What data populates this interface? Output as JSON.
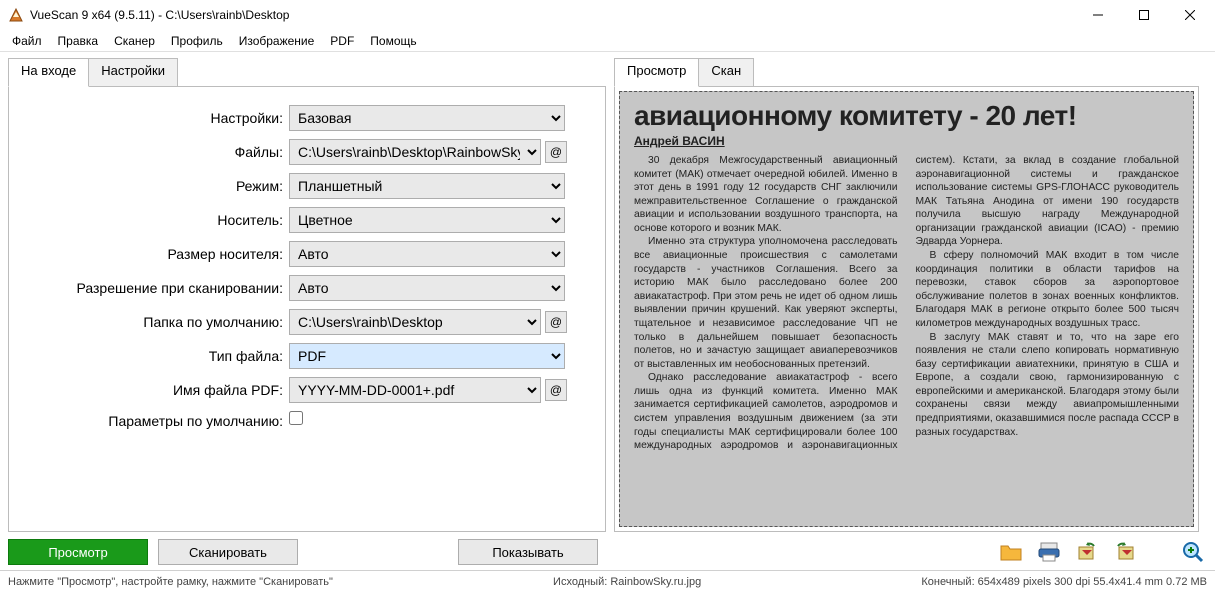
{
  "window": {
    "title": "VueScan 9 x64 (9.5.11) - C:\\Users\\rainb\\Desktop"
  },
  "menu": [
    "Файл",
    "Правка",
    "Сканер",
    "Профиль",
    "Изображение",
    "PDF",
    "Помощь"
  ],
  "left_tabs": [
    "На входе",
    "Настройки"
  ],
  "right_tabs": [
    "Просмотр",
    "Скан"
  ],
  "form": {
    "options_label": "Настройки:",
    "options_value": "Базовая",
    "files_label": "Файлы:",
    "files_value": "C:\\Users\\rainb\\Desktop\\RainbowSky",
    "mode_label": "Режим:",
    "mode_value": "Планшетный",
    "media_label": "Носитель:",
    "media_value": "Цветное",
    "mediasize_label": "Размер носителя:",
    "mediasize_value": "Авто",
    "resolution_label": "Разрешение при сканировании:",
    "resolution_value": "Авто",
    "default_folder_label": "Папка по умолчанию:",
    "default_folder_value": "C:\\Users\\rainb\\Desktop",
    "filetype_label": "Тип файла:",
    "filetype_value": "PDF",
    "pdfname_label": "Имя файла PDF:",
    "pdfname_value": "YYYY-MM-DD-0001+.pdf",
    "defaults_label": "Параметры по умолчанию:",
    "at": "@"
  },
  "buttons": {
    "preview": "Просмотр",
    "scan": "Сканировать",
    "show": "Показывать"
  },
  "status": {
    "left": "Нажмите \"Просмотр\", настройте рамку, нажмите \"Сканировать\"",
    "mid": "Исходный: RainbowSky.ru.jpg",
    "right": "Конечный: 654x489 pixels 300 dpi 55.4x41.4 mm 0.72 MB"
  },
  "article": {
    "headline": "авиационному комитету - 20 лет!",
    "byline": "Андрей ВАСИН",
    "p1": "30 декабря Межгосударственный авиационный комитет (МАК) отмечает очередной юбилей. Именно в этот день в 1991 году 12 государств СНГ заключили межправительственное Соглашение о гражданской авиации и использовании воздушного транспорта, на основе которого и возник МАК.",
    "p2": "Именно эта структура уполномочена расследовать все авиационные происшествия с самолетами государств - участников Соглашения. Всего за историю МАК было расследовано более 200 авиакатастроф. При этом речь не идет об одном лишь выявлении причин крушений. Как уверяют эксперты, тщательное и независимое расследование ЧП не только в дальнейшем повышает безопасность полетов, но и зачастую защищает авиаперевозчиков от выставленных им необоснованных претензий.",
    "p3": "Однако расследование авиакатастроф - всего лишь одна из функций комитета. Именно МАК занимается сертификацией самолетов, аэродромов и систем управления воздушным движением (за эти годы специалисты МАК сертифицировали более 100 международных аэродромов и аэронавигационных систем). Кстати, за вклад в создание глобальной аэронавигационной системы и гражданское использование системы GPS-ГЛОНАСС руководитель МАК Татьяна Анодина от имени 190 государств получила высшую награду Международной организации гражданской авиации (ICAO) - премию Эдварда Уорнера.",
    "p4": "В сферу полномочий МАК входит в том числе координация политики в области тарифов на перевозки, ставок сборов за аэропортовое обслуживание полетов в зонах военных конфликтов. Благодаря МАК в регионе открыто более 500 тысяч километров международных воздушных трасс.",
    "p5": "В заслугу МАК ставят и то, что на заре его появления не стали слепо копировать нормативную базу сертификации авиатехники, принятую в США и Европе, а создали свою, гармонизированную с европейскими и американской. Благодаря этому были сохранены связи между авиапромышленными предприятиями, оказавшимися после распада СССР в разных государствах."
  }
}
